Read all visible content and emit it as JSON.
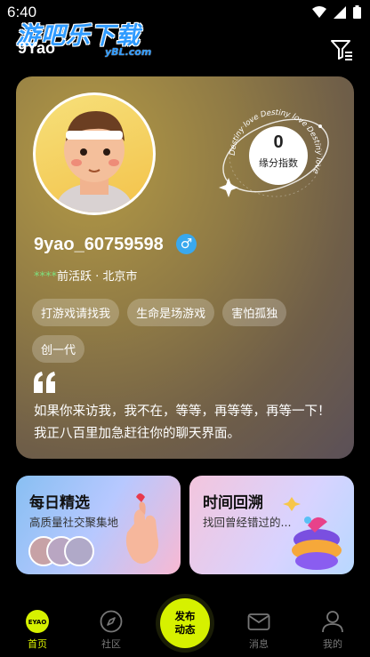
{
  "status": {
    "time": "6:40"
  },
  "watermark": {
    "title": "游吧乐下载",
    "url": "yBL.com"
  },
  "header": {
    "username": "9Yao"
  },
  "profile": {
    "score_value": "0",
    "score_label": "缘分指数",
    "ring_text": "Destiny love Destiny love Destiny love",
    "nickname": "9yao_60759598",
    "gender_symbol": "♂",
    "activity_stars": "****",
    "activity_text": "前活跃 · 北京市",
    "tags": [
      "打游戏请找我",
      "生命是场游戏",
      "害怕孤独",
      "创一代"
    ],
    "bio": "如果你来访我，我不在，等等，再等等，再等一下！我正八百里加急赶往你的聊天界面。"
  },
  "features": {
    "daily": {
      "title": "每日精选",
      "subtitle": "高质量社交聚集地"
    },
    "time": {
      "title": "时间回溯",
      "subtitle": "找回曾经错过的..."
    }
  },
  "tabbar": {
    "home": "首页",
    "community": "社区",
    "publish_line1": "发布",
    "publish_line2": "动态",
    "messages": "消息",
    "mine": "我的",
    "home_logo": "EYAO"
  },
  "colors": {
    "accent": "#d6f100",
    "gender": "#39a8ee",
    "stars": "#7ee07e"
  }
}
